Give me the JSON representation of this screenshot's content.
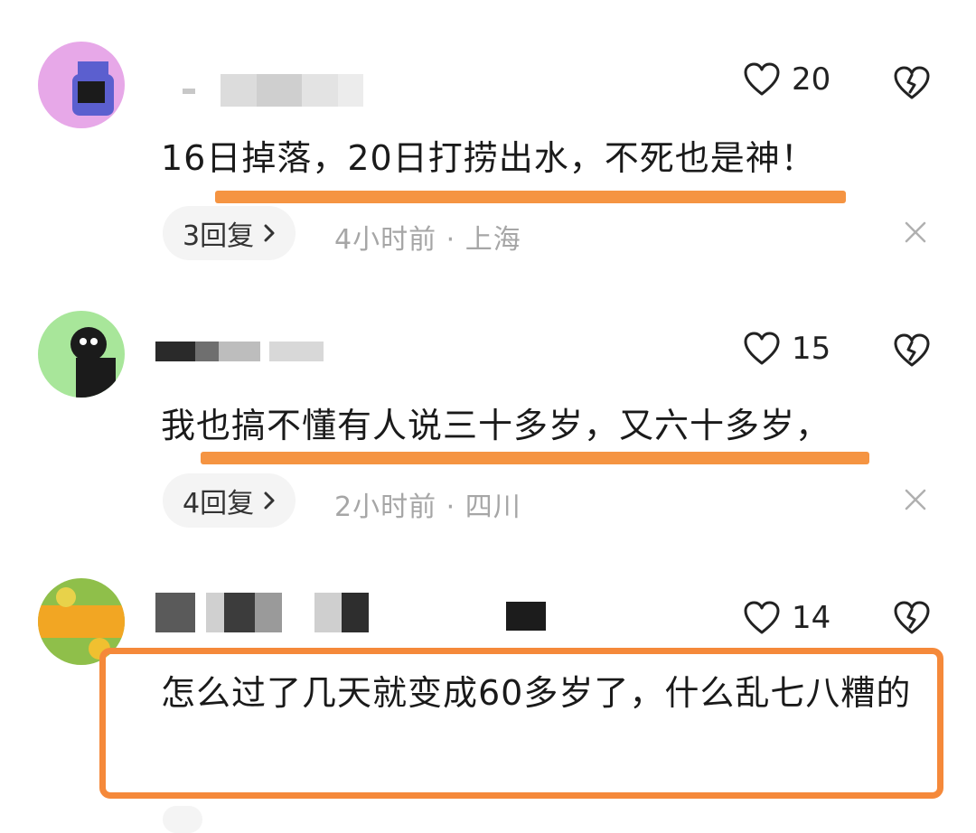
{
  "comments": [
    {
      "username": "",
      "like_count": "20",
      "text": "16日掉落，20日打捞出水，不死也是神！",
      "reply_label": "3回复",
      "meta": "4小时前 · 上海"
    },
    {
      "username": "",
      "like_count": "15",
      "text": "我也搞不懂有人说三十多岁，又六十多岁，",
      "reply_label": "4回复",
      "meta": "2小时前 · 四川"
    },
    {
      "username": "",
      "like_count": "14",
      "text": "怎么过了几天就变成60多岁了，什么乱七八糟的",
      "reply_label": "",
      "meta": ""
    }
  ],
  "colors": {
    "highlight": "#f59442",
    "box": "#f5893a"
  },
  "icons": {
    "like": "heart-outline-icon",
    "dislike": "broken-heart-icon",
    "reply_arrow": "chevron-right-icon",
    "dismiss": "close-icon"
  }
}
